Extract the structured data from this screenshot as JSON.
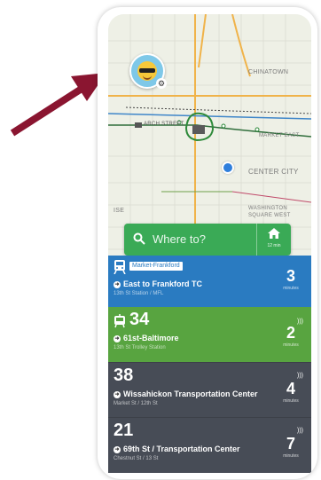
{
  "map": {
    "labels": {
      "chinatown": "CHINATOWN",
      "market_east": "MARKET EAST",
      "center_city": "CENTER CITY",
      "washington_square": "WASHINGTON",
      "washington_square_2": "SQUARE WEST",
      "ise": "ISE",
      "arch_street": "ARCH STREET"
    }
  },
  "search": {
    "placeholder": "Where to?",
    "home_minutes": "12 min"
  },
  "cards": [
    {
      "type": "train",
      "badge": "Market-Frankford",
      "destination": "East to Frankford TC",
      "stop": "13th St Station / MFL",
      "minutes": "3",
      "unit": "minutes",
      "color": "#2a7bc1"
    },
    {
      "type": "trolley",
      "route": "34",
      "destination": "61st-Baltimore",
      "stop": "13th St Trolley Station",
      "minutes": "2",
      "unit": "minutes",
      "color": "#58a440"
    },
    {
      "type": "bus",
      "route": "38",
      "destination": "Wissahickon Transportation Center",
      "stop": "Market St / 12th St",
      "minutes": "4",
      "unit": "minutes",
      "color": "#474c56"
    },
    {
      "type": "bus",
      "route": "21",
      "destination": "69th St / Transportation Center",
      "stop": "Chestnut St / 13 St",
      "minutes": "7",
      "unit": "minutes",
      "color": "#474c56"
    }
  ]
}
